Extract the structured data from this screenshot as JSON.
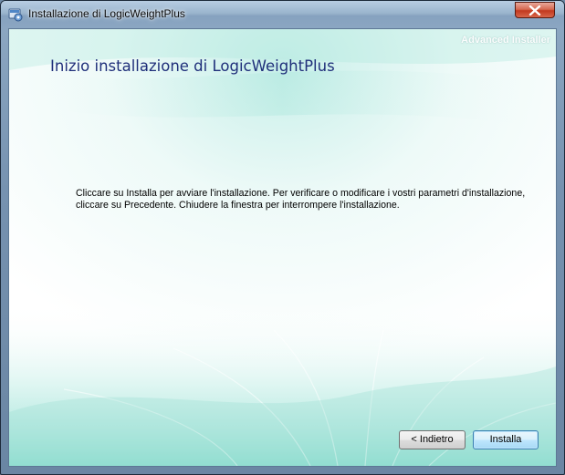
{
  "window": {
    "title": "Installazione di LogicWeightPlus",
    "close_glyph": "X"
  },
  "branding": "Advanced Installer",
  "page": {
    "heading": "Inizio installazione di LogicWeightPlus",
    "body_lines": [
      "Cliccare su Installa per avviare l'installazione. Per verificare o modificare i vostri parametri d'installazione,",
      "cliccare su Precedente. Chiudere la finestra per interrompere l'installazione."
    ]
  },
  "buttons": {
    "back_label": "< Indietro",
    "install_label": "Installa"
  },
  "colors": {
    "heading": "#1f2f7a",
    "accent_teal": "#3cc6b4",
    "close_red": "#c2391f",
    "default_button_border": "#3c7fb1"
  },
  "icons": {
    "app": "installer-icon",
    "close": "close-icon"
  }
}
